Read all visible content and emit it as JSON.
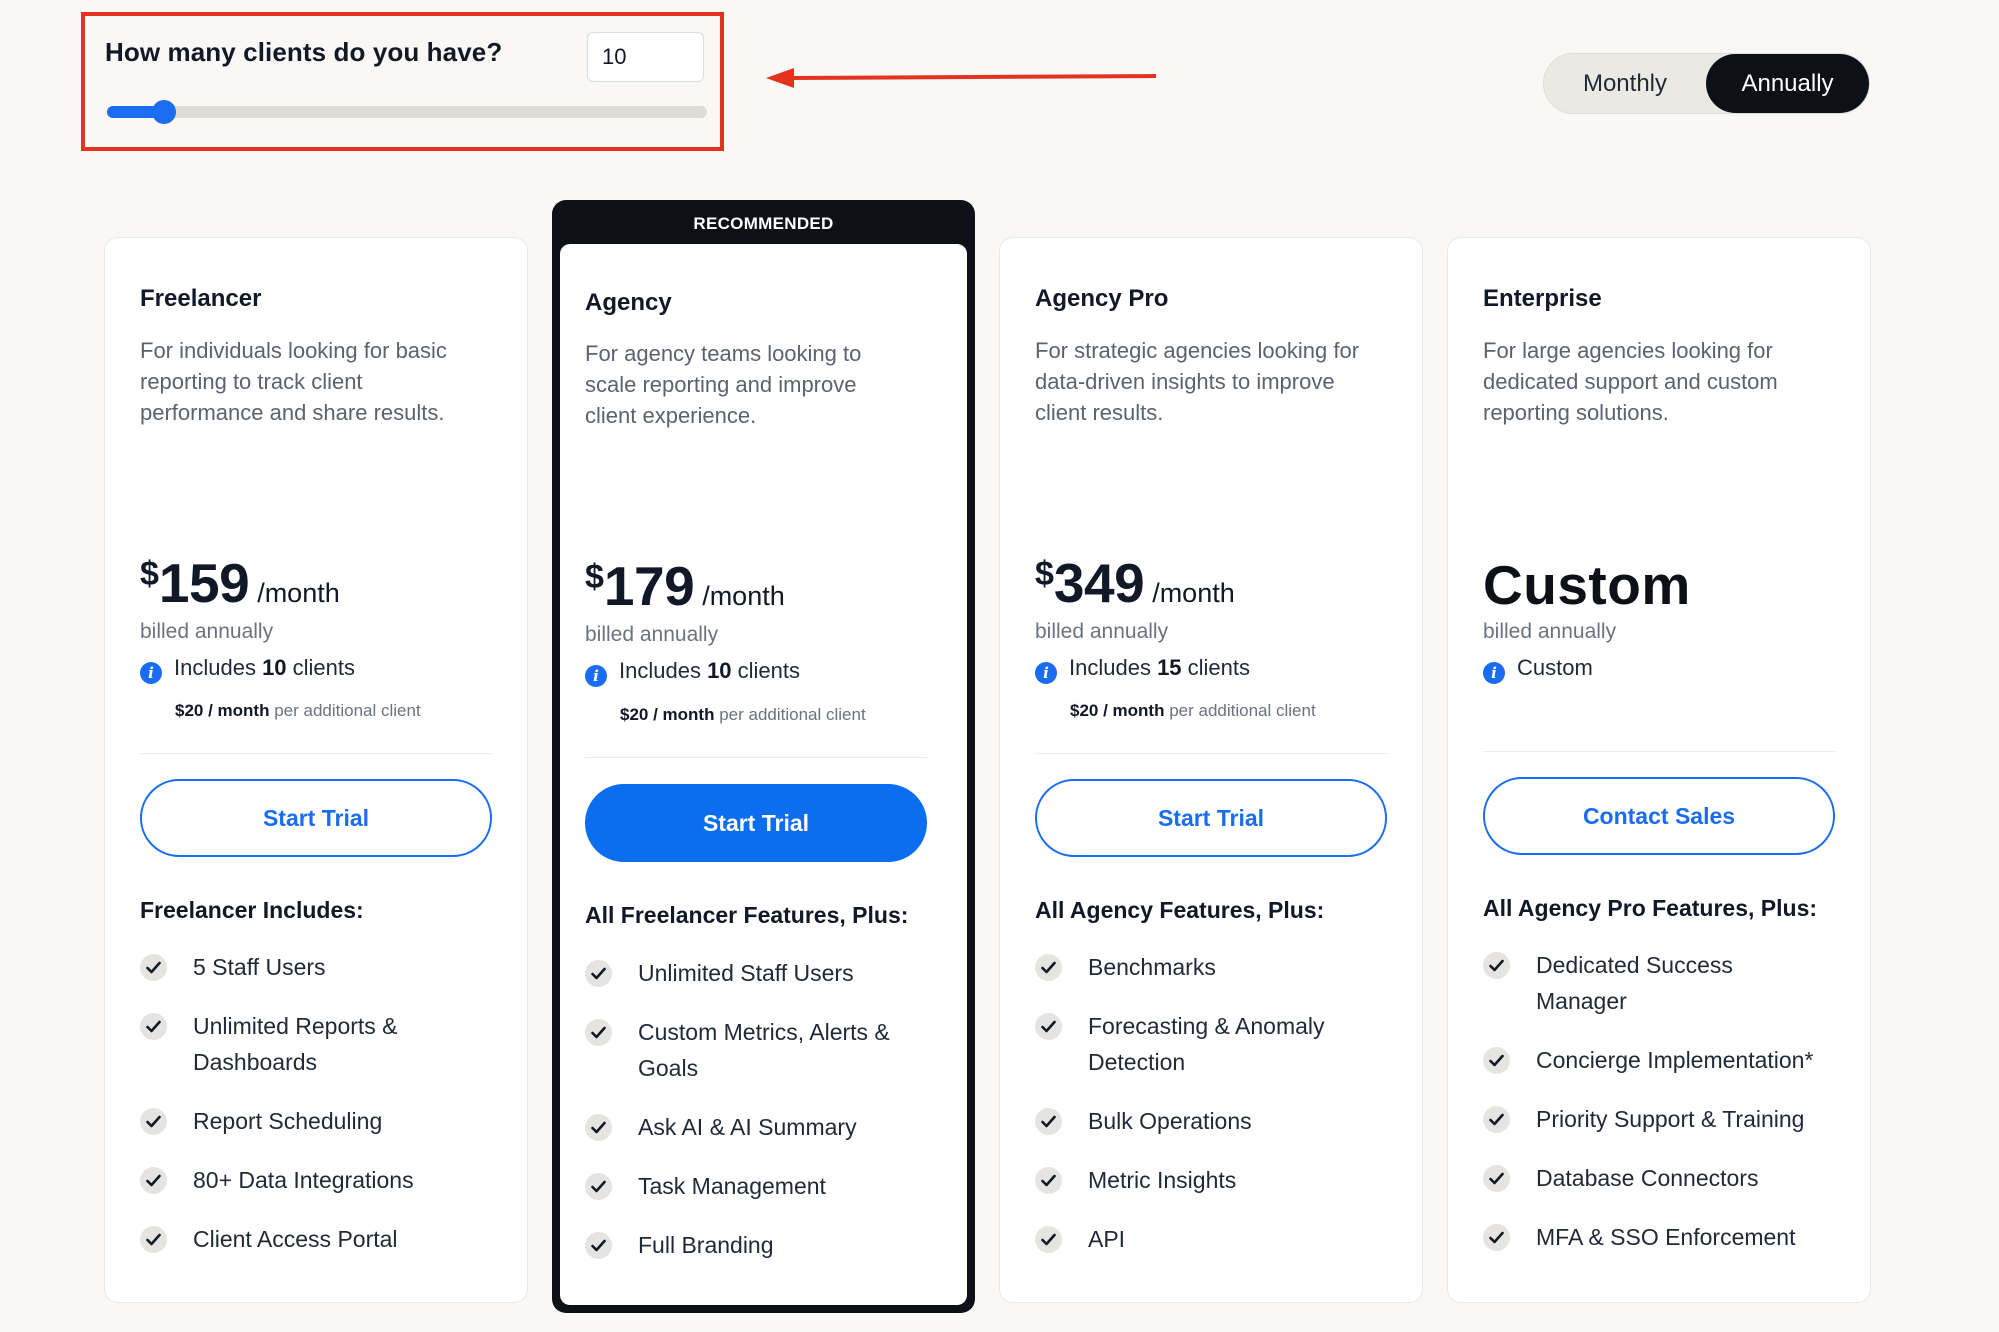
{
  "clients": {
    "label": "How many clients do you have?",
    "value": "10",
    "slider_fraction": 0.095
  },
  "billing_toggle": {
    "options": [
      "Monthly",
      "Annually"
    ],
    "selected": "Annually"
  },
  "colors": {
    "accent_blue": "#1a6cf0",
    "annotation_red": "#e5321f",
    "dark": "#0d1117"
  },
  "plans": [
    {
      "name": "Freelancer",
      "description": "For individuals looking for basic reporting to track client performance and share results.",
      "currency": "$",
      "price": "159",
      "per": "/month",
      "billed": "billed annually",
      "includes_prefix": "Includes ",
      "includes_count": "10",
      "includes_suffix": " clients",
      "additional_price": "$20 / month",
      "additional_text": " per additional client",
      "cta": "Start Trial",
      "features_heading": "Freelancer Includes:",
      "features": [
        "5 Staff Users",
        "Unlimited Reports & Dashboards",
        "Report Scheduling",
        "80+ Data Integrations",
        "Client Access Portal"
      ]
    },
    {
      "badge": "RECOMMENDED",
      "name": "Agency",
      "description": "For agency teams looking to scale reporting and improve client experience.",
      "currency": "$",
      "price": "179",
      "per": "/month",
      "billed": "billed annually",
      "includes_prefix": "Includes ",
      "includes_count": "10",
      "includes_suffix": " clients",
      "additional_price": "$20 / month",
      "additional_text": " per additional client",
      "cta": "Start Trial",
      "features_heading": "All Freelancer Features, Plus:",
      "features": [
        "Unlimited Staff Users",
        "Custom Metrics, Alerts & Goals",
        "Ask AI & AI Summary",
        "Task Management",
        "Full Branding"
      ]
    },
    {
      "name": "Agency Pro",
      "description": "For strategic agencies looking for data-driven insights to improve client results.",
      "currency": "$",
      "price": "349",
      "per": "/month",
      "billed": "billed annually",
      "includes_prefix": "Includes ",
      "includes_count": "15",
      "includes_suffix": " clients",
      "additional_price": "$20 / month",
      "additional_text": " per additional client",
      "cta": "Start Trial",
      "features_heading": "All Agency Features, Plus:",
      "features": [
        "Benchmarks",
        "Forecasting & Anomaly Detection",
        "Bulk Operations",
        "Metric Insights",
        "API"
      ]
    },
    {
      "name": "Enterprise",
      "description": "For large agencies looking for dedicated support and custom reporting solutions.",
      "price_custom": "Custom",
      "billed": "billed annually",
      "includes_text": "Custom",
      "cta": "Contact Sales",
      "features_heading": "All Agency Pro Features, Plus:",
      "features": [
        "Dedicated Success Manager",
        "Concierge Implementation*",
        "Priority Support & Training",
        "Database Connectors",
        "MFA & SSO Enforcement"
      ]
    }
  ]
}
